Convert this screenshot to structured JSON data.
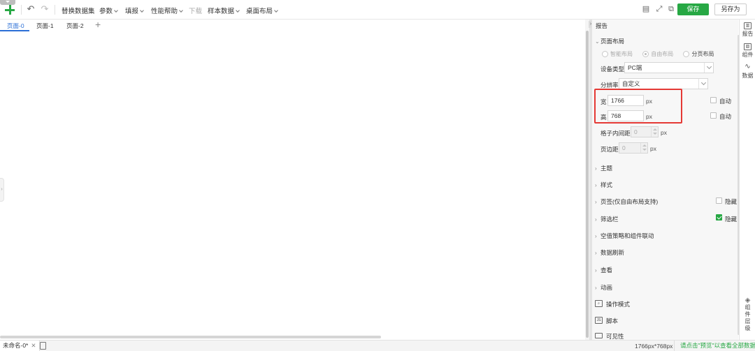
{
  "toolbar": {
    "menus": [
      "替换数据集",
      "参数",
      "填报",
      "性能帮助",
      "下载",
      "样本数据",
      "桌面布局"
    ],
    "save_label": "保存",
    "save_as_label": "另存为",
    "accent": "#27a844"
  },
  "tabs": [
    "页面-0",
    "页面-1",
    "页面-2"
  ],
  "panel": {
    "title": "报告",
    "page_layout": {
      "section_label": "页面布局",
      "layout_options": [
        "智能布局",
        "自由布局",
        "分页布局"
      ],
      "selected_layout": "自由布局",
      "device_type_label": "设备类型",
      "device_type_value": "PC端",
      "resolution_label": "分辨率",
      "resolution_value": "自定义",
      "width_label": "宽",
      "width_value": "1766",
      "height_label": "高",
      "height_value": "768",
      "unit": "px",
      "auto_label": "自动",
      "cell_padding_label": "格子内间距",
      "cell_padding_value": "0",
      "page_margin_label": "页边距",
      "page_margin_value": "0"
    },
    "sections": [
      {
        "label": "主题"
      },
      {
        "label": "样式"
      },
      {
        "label": "页签(仅自由布局支持)",
        "toggle_label": "隐藏",
        "checked": false
      },
      {
        "label": "筛选栏",
        "toggle_label": "隐藏",
        "checked": true
      },
      {
        "label": "空值策略和组件联动"
      },
      {
        "label": "数据刷新"
      },
      {
        "label": "查看"
      },
      {
        "label": "动画"
      }
    ],
    "extra_rows": [
      {
        "label": "操作模式",
        "icon": "operation-mode-icon"
      },
      {
        "label": "脚本",
        "icon_text": "JS"
      },
      {
        "label": "可见性"
      }
    ]
  },
  "rail": {
    "items": [
      "报告",
      "组件",
      "数据"
    ],
    "bottom": [
      "组",
      "件",
      "层",
      "级"
    ]
  },
  "status": {
    "sheet_name": "未命名-0*",
    "size": "1766px*768px",
    "hint": "请点击\"预览\"以查看全部数据"
  }
}
